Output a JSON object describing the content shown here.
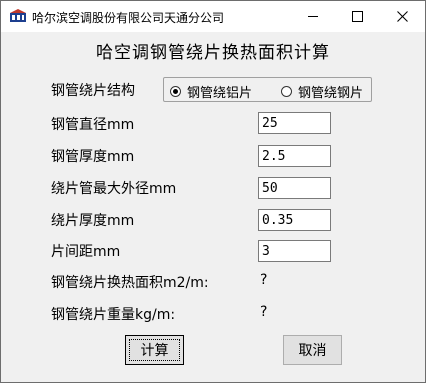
{
  "window": {
    "title": "哈尔滨空调股份有限公司天通分公司",
    "icon": "app-logo-icon",
    "controls": [
      "minimize-icon",
      "maximize-icon",
      "close-icon"
    ]
  },
  "heading": "哈空调钢管绕片换热面积计算",
  "structure": {
    "label": "钢管绕片结构",
    "options": [
      {
        "label": "钢管绕铝片",
        "checked": true
      },
      {
        "label": "钢管绕钢片",
        "checked": false
      }
    ]
  },
  "fields": [
    {
      "label": "钢管直径mm",
      "value": "25"
    },
    {
      "label": "钢管厚度mm",
      "value": "2.5"
    },
    {
      "label": "绕片管最大外径mm",
      "value": "50"
    },
    {
      "label": "绕片厚度mm",
      "value": "0.35"
    },
    {
      "label": "片间距mm",
      "value": "3"
    }
  ],
  "results": [
    {
      "label": "钢管绕片换热面积m2/m:",
      "value": "?"
    },
    {
      "label": "钢管绕片重量kg/m:",
      "value": "?"
    }
  ],
  "buttons": {
    "calculate": "计算",
    "cancel": "取消"
  }
}
